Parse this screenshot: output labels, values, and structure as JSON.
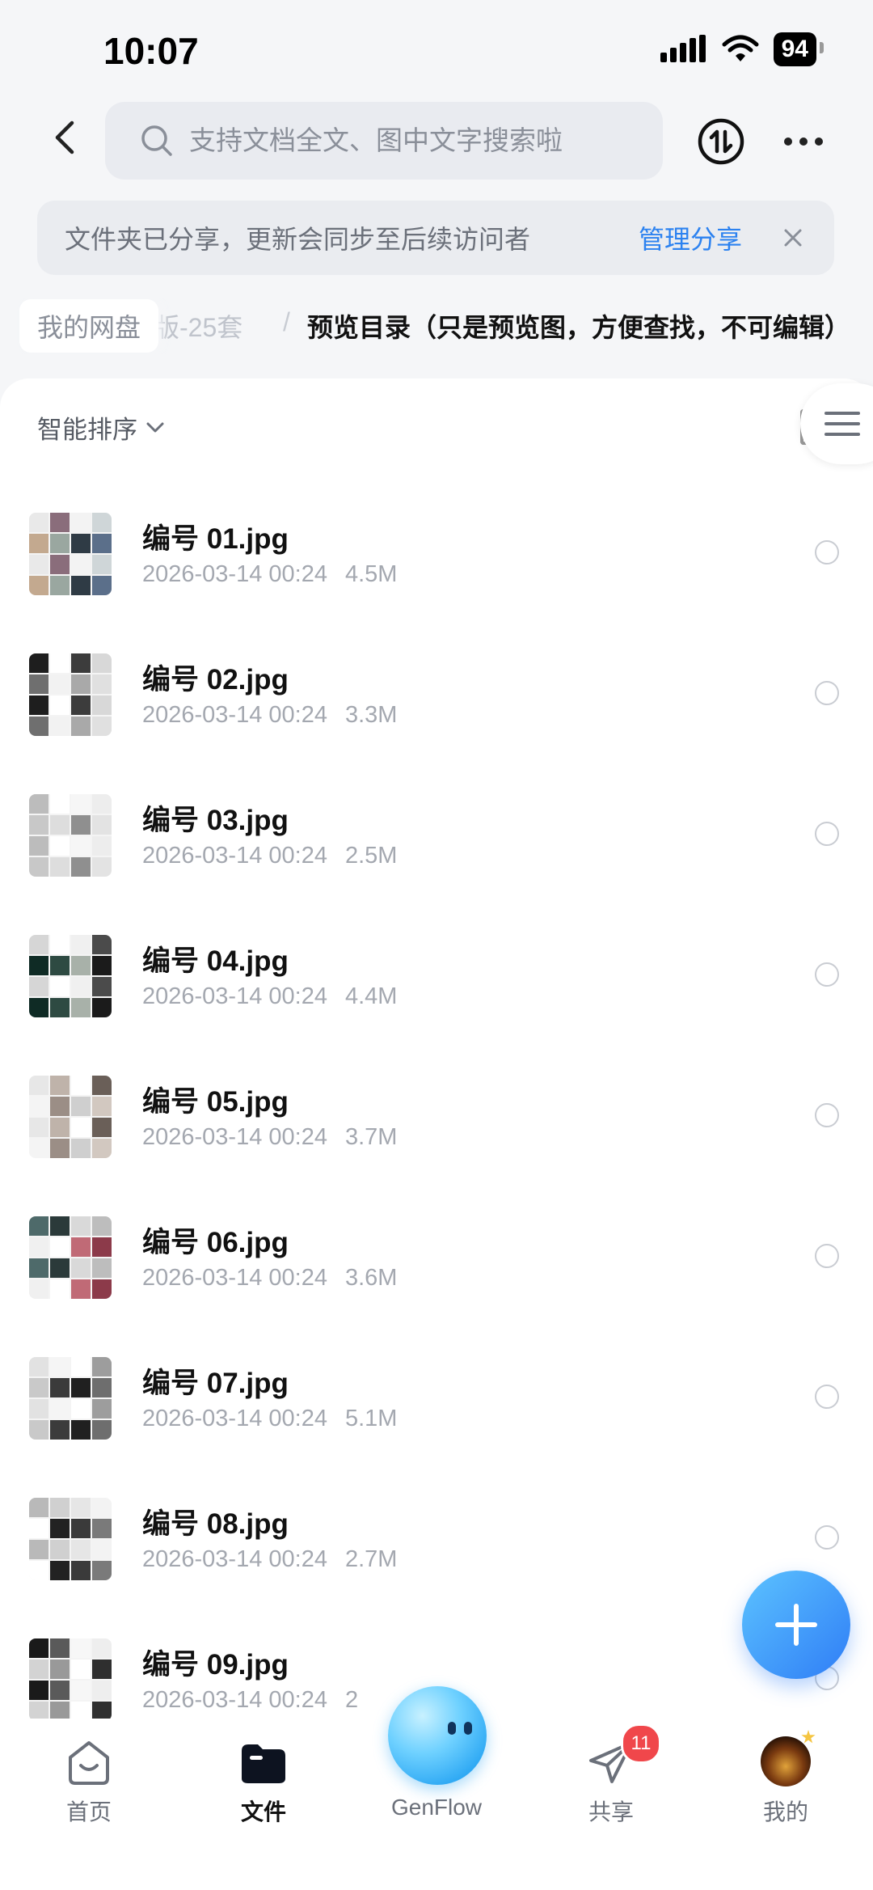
{
  "status_bar": {
    "time": "10:07",
    "battery": "94"
  },
  "search": {
    "placeholder": "支持文档全文、图中文字搜索啦"
  },
  "share_banner": {
    "message": "文件夹已分享，更新会同步至后续访问者",
    "action": "管理分享"
  },
  "breadcrumb": {
    "root": "我的网盘",
    "previous": "版-25套",
    "current": "预览目录（只是预览图，方便查找，不可编辑）"
  },
  "toolbar": {
    "sort_label": "智能排序"
  },
  "files": [
    {
      "name": "编号 01.jpg",
      "date": "2026-03-14 00:24",
      "size": "4.5M"
    },
    {
      "name": "编号 02.jpg",
      "date": "2026-03-14 00:24",
      "size": "3.3M"
    },
    {
      "name": "编号 03.jpg",
      "date": "2026-03-14 00:24",
      "size": "2.5M"
    },
    {
      "name": "编号 04.jpg",
      "date": "2026-03-14 00:24",
      "size": "4.4M"
    },
    {
      "name": "编号 05.jpg",
      "date": "2026-03-14 00:24",
      "size": "3.7M"
    },
    {
      "name": "编号 06.jpg",
      "date": "2026-03-14 00:24",
      "size": "3.6M"
    },
    {
      "name": "编号 07.jpg",
      "date": "2026-03-14 00:24",
      "size": "5.1M"
    },
    {
      "name": "编号 08.jpg",
      "date": "2026-03-14 00:24",
      "size": "2.7M"
    },
    {
      "name": "编号 09.jpg",
      "date": "2026-03-14 00:24",
      "size": "2"
    }
  ],
  "tabbar": {
    "items": [
      {
        "label": "首页"
      },
      {
        "label": "文件"
      },
      {
        "label": "GenFlow"
      },
      {
        "label": "共享",
        "badge": "11"
      },
      {
        "label": "我的"
      }
    ]
  },
  "colors": {
    "accent": "#2c82f0",
    "badge": "#f0474b",
    "fab": "#3a8ef7"
  }
}
